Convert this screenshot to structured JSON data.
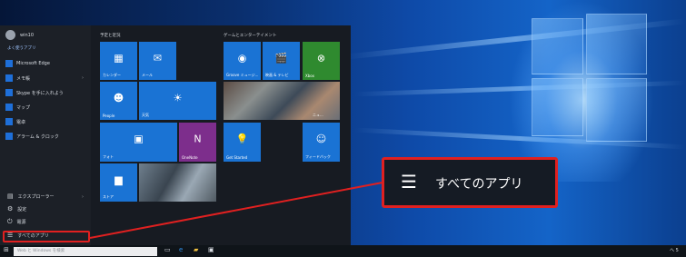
{
  "start_menu": {
    "user_name": "win10",
    "section_most_used": "よく使うアプリ",
    "apps": [
      {
        "label": "Microsoft Edge",
        "icon": "edge-icon"
      },
      {
        "label": "メモ帳",
        "icon": "notepad-icon"
      },
      {
        "label": "Skype を手に入れよう",
        "icon": "skype-icon"
      },
      {
        "label": "マップ",
        "icon": "maps-icon"
      },
      {
        "label": "電卓",
        "icon": "calculator-icon"
      },
      {
        "label": "アラーム & クロック",
        "icon": "alarm-icon"
      }
    ],
    "system_items": [
      {
        "label": "エクスプローラー",
        "icon": "folder-icon"
      },
      {
        "label": "設定",
        "icon": "gear-icon"
      },
      {
        "label": "電源",
        "icon": "power-icon"
      },
      {
        "label": "すべてのアプリ",
        "icon": "all-apps-icon"
      }
    ],
    "groups": {
      "left_title": "予定と近況",
      "right_title": "ゲームとエンターテイメント"
    },
    "tiles": {
      "calendar": "カレンダー",
      "mail": "メール",
      "people": "People",
      "weather": "天気",
      "photos": "フォト",
      "onenote": "OneNote",
      "store": "ストア",
      "groove": "Groove ミュージ...",
      "movies": "映画 & テレビ",
      "xbox": "Xbox",
      "news": "ニュ...",
      "get_started": "Get Started",
      "feedback": "フィードバック"
    }
  },
  "taskbar": {
    "search_placeholder": "Web と Windows を検索",
    "clock": "へ 5"
  },
  "callout": {
    "label": "すべてのアプリ",
    "icon": "all-apps-list-icon"
  },
  "colors": {
    "tile_blue": "#1a73d4",
    "xbox_green": "#2f8a2f",
    "onenote_purple": "#7d2e8c",
    "highlight_red": "#e02020"
  }
}
